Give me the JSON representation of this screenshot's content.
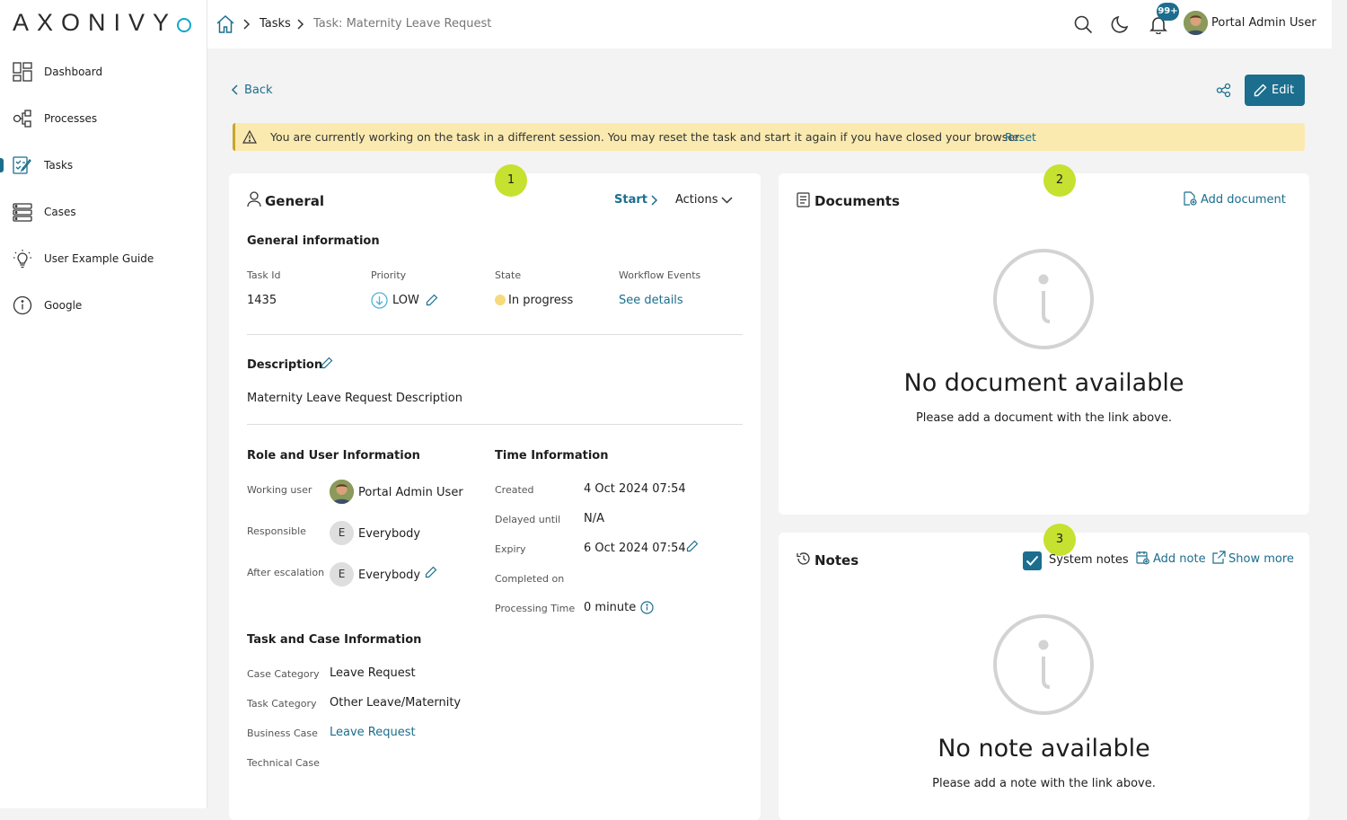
{
  "app": {
    "logo_text": "AXONIVY"
  },
  "sidebar": {
    "items": [
      {
        "label": "Dashboard",
        "icon": "dashboard-icon"
      },
      {
        "label": "Processes",
        "icon": "processes-icon"
      },
      {
        "label": "Tasks",
        "icon": "tasks-icon",
        "active": true
      },
      {
        "label": "Cases",
        "icon": "cases-icon"
      },
      {
        "label": "User Example Guide",
        "icon": "lightbulb-icon"
      },
      {
        "label": "Google",
        "icon": "info-icon"
      }
    ]
  },
  "header": {
    "breadcrumb": [
      "Tasks",
      "Task: Maternity Leave Request"
    ],
    "notification_badge": "99+",
    "user_name": "Portal Admin User"
  },
  "toolbar": {
    "back_label": "Back",
    "edit_label": "Edit"
  },
  "warning": {
    "text": "You are currently working on the task in a different session. You may reset the task and start it again if you have closed your browser.",
    "reset_label": "Reset"
  },
  "steps": [
    "1",
    "2",
    "3"
  ],
  "general": {
    "title": "General",
    "start_label": "Start",
    "actions_label": "Actions",
    "info_title": "General information",
    "task_id_label": "Task Id",
    "task_id": "1435",
    "priority_label": "Priority",
    "priority": "LOW",
    "state_label": "State",
    "state": "In progress",
    "workflow_label": "Workflow Events",
    "workflow_link": "See details",
    "description_title": "Description",
    "description": "Maternity Leave Request Description",
    "role_title": "Role and User Information",
    "working_user_label": "Working user",
    "working_user": "Portal Admin User",
    "responsible_label": "Responsible",
    "responsible": "Everybody",
    "responsible_initial": "E",
    "after_escalation_label": "After escalation",
    "after_escalation": "Everybody",
    "after_escalation_initial": "E",
    "time_title": "Time Information",
    "created_label": "Created",
    "created": "4 Oct 2024 07:54",
    "delayed_label": "Delayed until",
    "delayed": "N/A",
    "expiry_label": "Expiry",
    "expiry": "6 Oct 2024 07:54",
    "completed_label": "Completed on",
    "completed": "",
    "processing_label": "Processing Time",
    "processing": "0 minute",
    "taskcase_title": "Task and Case Information",
    "case_category_label": "Case Category",
    "case_category": "Leave Request",
    "task_category_label": "Task Category",
    "task_category": "Other Leave/Maternity",
    "business_case_label": "Business Case",
    "business_case": "Leave Request",
    "technical_case_label": "Technical Case",
    "technical_case": ""
  },
  "documents": {
    "title": "Documents",
    "add_label": "Add document",
    "empty_title": "No document available",
    "empty_sub": "Please add a document with the link above."
  },
  "notes": {
    "title": "Notes",
    "system_notes_label": "System notes",
    "system_notes_checked": true,
    "add_label": "Add note",
    "show_more_label": "Show more",
    "empty_title": "No note available",
    "empty_sub": "Please add a note with the link above."
  },
  "colors": {
    "primary": "#1b6e8d",
    "step": "#c6e12f",
    "warning_bg": "#fbeab0",
    "state": "#f7db7a"
  }
}
